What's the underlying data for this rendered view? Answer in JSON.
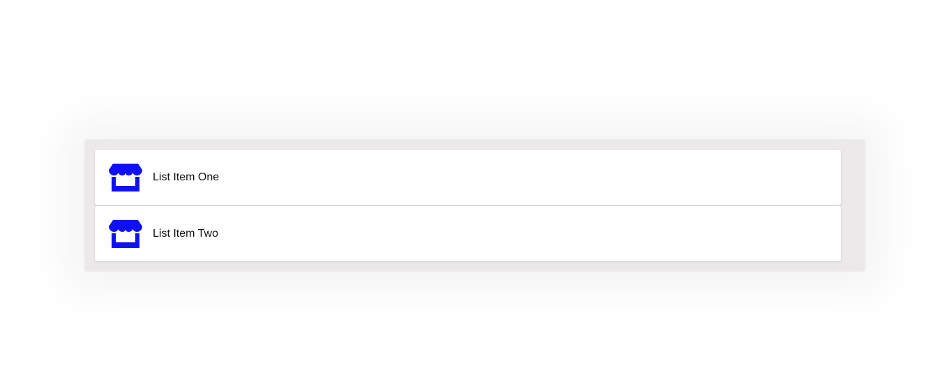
{
  "list": {
    "items": [
      {
        "label": "List Item One",
        "icon": "store-icon"
      },
      {
        "label": "List Item Two",
        "icon": "store-icon"
      }
    ]
  },
  "colors": {
    "icon": "#1010f5",
    "container_bg": "#ebe9ea",
    "item_bg": "#ffffff",
    "text": "#111111"
  }
}
